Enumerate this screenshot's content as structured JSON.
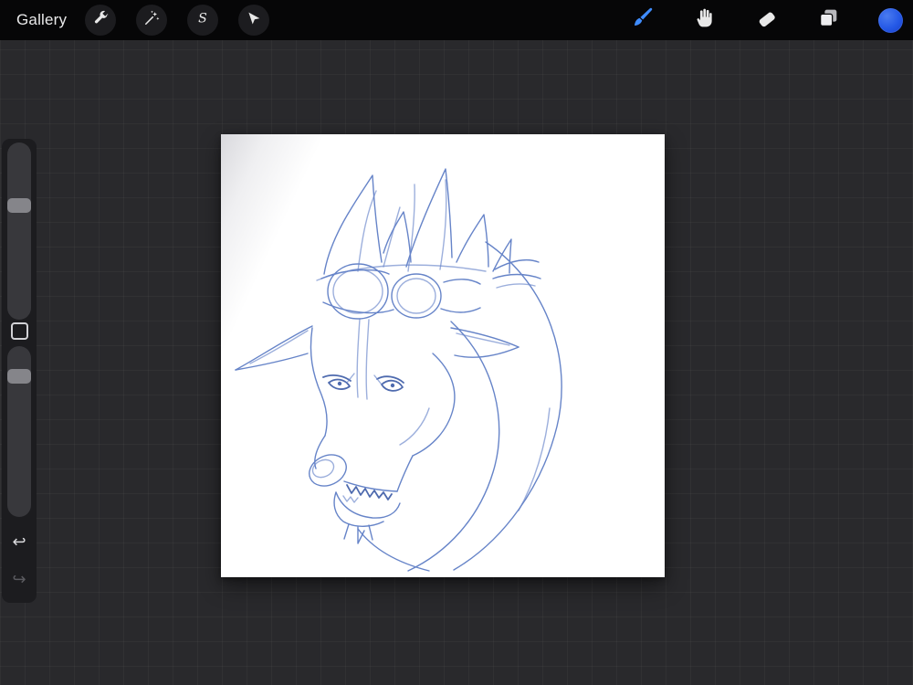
{
  "topbar": {
    "gallery_label": "Gallery",
    "selection_glyph": "S",
    "left_tools": [
      {
        "id": "actions",
        "icon": "wrench-icon"
      },
      {
        "id": "adjustments",
        "icon": "magic-wand-icon"
      },
      {
        "id": "selection",
        "icon": "selection-s-icon"
      },
      {
        "id": "transform",
        "icon": "transform-arrow-icon"
      }
    ],
    "right_tools": [
      {
        "id": "paint",
        "icon": "brush-icon",
        "active": true,
        "active_color": "#3f8cfd"
      },
      {
        "id": "smudge",
        "icon": "smudge-hand-icon",
        "active": false
      },
      {
        "id": "erase",
        "icon": "eraser-icon",
        "active": false
      },
      {
        "id": "layers",
        "icon": "layers-icon",
        "active": false
      },
      {
        "id": "color",
        "icon": "color-swatch",
        "value": "#2458e6"
      }
    ]
  },
  "sidebar": {
    "brush_size_slider": {
      "handle_position_percent": 34
    },
    "opacity_slider": {
      "handle_position_percent": 15
    },
    "modify_button": {
      "shape": "square-outline"
    },
    "undo_glyph": "↩",
    "redo_glyph": "↪",
    "redo_enabled": false
  },
  "canvas": {
    "background": "#ffffff",
    "sketch": {
      "subject": "horned dragon head with goggles on forehead, angry eyes, open toothy jaw and long curved neck",
      "medium": "blue pencil sketch",
      "stroke_color": "#5a7ac4"
    }
  }
}
